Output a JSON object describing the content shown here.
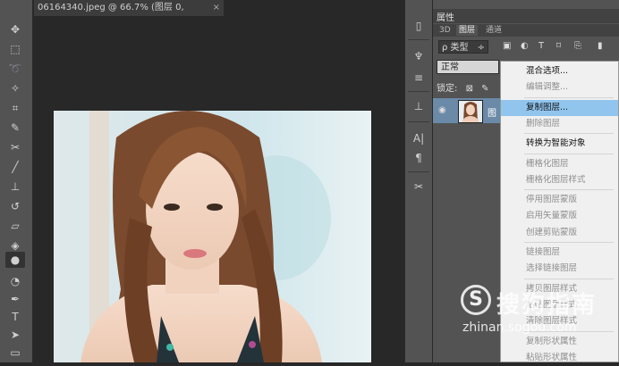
{
  "document_tab": {
    "title": "06164340.jpeg @ 66.7% (图层 0, RGB/8#) *",
    "close": "×"
  },
  "toolbar_icons": [
    "move-icon",
    "marquee-icon",
    "lasso-icon",
    "magic-wand-icon",
    "crop-icon",
    "eyedropper-icon",
    "healing-brush-icon",
    "brush-icon",
    "clone-stamp-icon",
    "history-brush-icon",
    "eraser-icon",
    "paint-bucket-icon",
    "blur-icon",
    "dodge-icon",
    "pen-icon",
    "type-icon",
    "path-selection-icon",
    "rectangle-icon"
  ],
  "panels": {
    "top_tab": "属性",
    "tabs": [
      "3D",
      "图层",
      "通道"
    ],
    "active_tab": "图层",
    "filter": {
      "kind_label": "ρ 类型",
      "arrow": "÷"
    },
    "blend_mode": "正常",
    "lock_label": "锁定:",
    "layer": {
      "name": "图",
      "visible_icon": "eye-icon"
    }
  },
  "context_menu": [
    {
      "label": "混合选项...",
      "disabled": false
    },
    {
      "label": "编辑调整...",
      "disabled": true
    },
    {
      "sep": true
    },
    {
      "label": "复制图层...",
      "disabled": false,
      "highlighted": true
    },
    {
      "label": "删除图层",
      "disabled": true
    },
    {
      "sep": true
    },
    {
      "label": "转换为智能对象",
      "disabled": false
    },
    {
      "sep": true
    },
    {
      "label": "栅格化图层",
      "disabled": true
    },
    {
      "label": "栅格化图层样式",
      "disabled": true
    },
    {
      "sep": true
    },
    {
      "label": "停用图层蒙版",
      "disabled": true
    },
    {
      "label": "启用矢量蒙版",
      "disabled": true
    },
    {
      "label": "创建剪贴蒙版",
      "disabled": true
    },
    {
      "sep": true
    },
    {
      "label": "链接图层",
      "disabled": true
    },
    {
      "label": "选择链接图层",
      "disabled": true
    },
    {
      "sep": true
    },
    {
      "label": "拷贝图层样式",
      "disabled": true
    },
    {
      "label": "粘贴图层样式",
      "disabled": true
    },
    {
      "label": "清除图层样式",
      "disabled": true
    },
    {
      "sep": true
    },
    {
      "label": "复制形状属性",
      "disabled": true
    },
    {
      "label": "粘贴形状属性",
      "disabled": true
    }
  ],
  "watermark": {
    "logo_letter": "S",
    "cn": "搜狗指南",
    "en": "zhinan.sogou.com"
  }
}
